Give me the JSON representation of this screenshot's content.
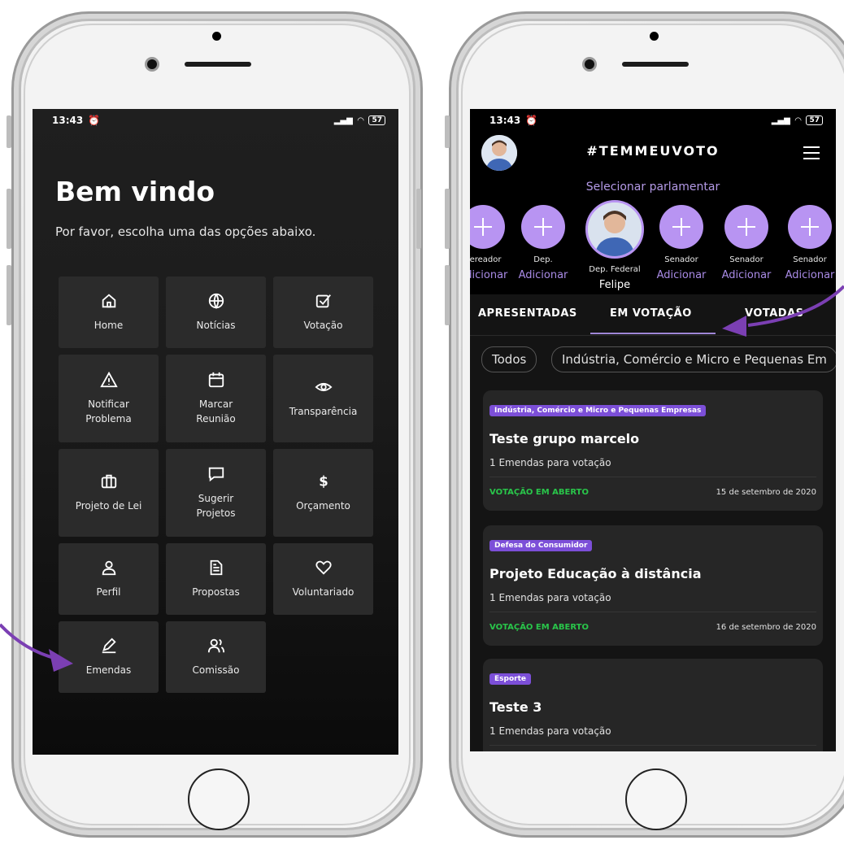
{
  "left_phone": {
    "status": {
      "time": "13:43",
      "battery": "57"
    },
    "title": "Bem vindo",
    "subtitle": "Por favor, escolha uma das opções abaixo.",
    "tiles": [
      {
        "label": "Home",
        "icon": "home-icon"
      },
      {
        "label": "Notícias",
        "icon": "globe-icon"
      },
      {
        "label": "Votação",
        "icon": "checkbox-icon"
      },
      {
        "label": "Notificar\nProblema",
        "icon": "warning-icon"
      },
      {
        "label": "Marcar\nReunião",
        "icon": "calendar-icon"
      },
      {
        "label": "Transparência",
        "icon": "eye-icon"
      },
      {
        "label": "Projeto de Lei",
        "icon": "briefcase-icon"
      },
      {
        "label": "Sugerir\nProjetos",
        "icon": "comment-icon"
      },
      {
        "label": "Orçamento",
        "icon": "dollar-icon"
      },
      {
        "label": "Perfil",
        "icon": "user-icon"
      },
      {
        "label": "Propostas",
        "icon": "document-icon"
      },
      {
        "label": "Voluntariado",
        "icon": "heart-icon"
      },
      {
        "label": "Emendas",
        "icon": "pen-icon"
      },
      {
        "label": "Comissão",
        "icon": "users-icon"
      }
    ]
  },
  "right_phone": {
    "status": {
      "time": "13:43",
      "battery": "57"
    },
    "brand": "#TEMMEUVOTO",
    "select_label": "Selecionar parlamentar",
    "parlamentares": [
      {
        "role": "Vereador",
        "action": "Adicionar",
        "photo": false
      },
      {
        "role": "Dep.",
        "action": "Adicionar",
        "photo": false
      },
      {
        "role": "Dep. Federal",
        "action": "Felipe",
        "photo": true
      },
      {
        "role": "Senador",
        "action": "Adicionar",
        "photo": false
      },
      {
        "role": "Senador",
        "action": "Adicionar",
        "photo": false
      },
      {
        "role": "Senador",
        "action": "Adicionar",
        "photo": false
      }
    ],
    "tabs": [
      "APRESENTADAS",
      "EM VOTAÇÃO",
      "VOTADAS"
    ],
    "active_tab": "EM VOTAÇÃO",
    "filters": [
      "Todos",
      "Indústria, Comércio e Micro e Pequenas Em"
    ],
    "cards": [
      {
        "category": "Indústria, Comércio e Micro e Pequenas Empresas",
        "title": "Teste grupo marcelo",
        "subtitle": "1 Emendas para votação",
        "status": "VOTAÇÃO EM ABERTO",
        "date": "15 de setembro de 2020"
      },
      {
        "category": "Defesa do Consumidor",
        "title": "Projeto Educação à distância",
        "subtitle": "1 Emendas para votação",
        "status": "VOTAÇÃO EM ABERTO",
        "date": "16 de setembro de 2020"
      },
      {
        "category": "Esporte",
        "title": "Teste 3",
        "subtitle": "1 Emendas para votação",
        "status": "",
        "date": ""
      }
    ]
  },
  "colors": {
    "accent": "#b894f2",
    "arrow": "#7b3fb3",
    "status_green": "#29c64a",
    "category_bg": "#7c4fd8"
  }
}
